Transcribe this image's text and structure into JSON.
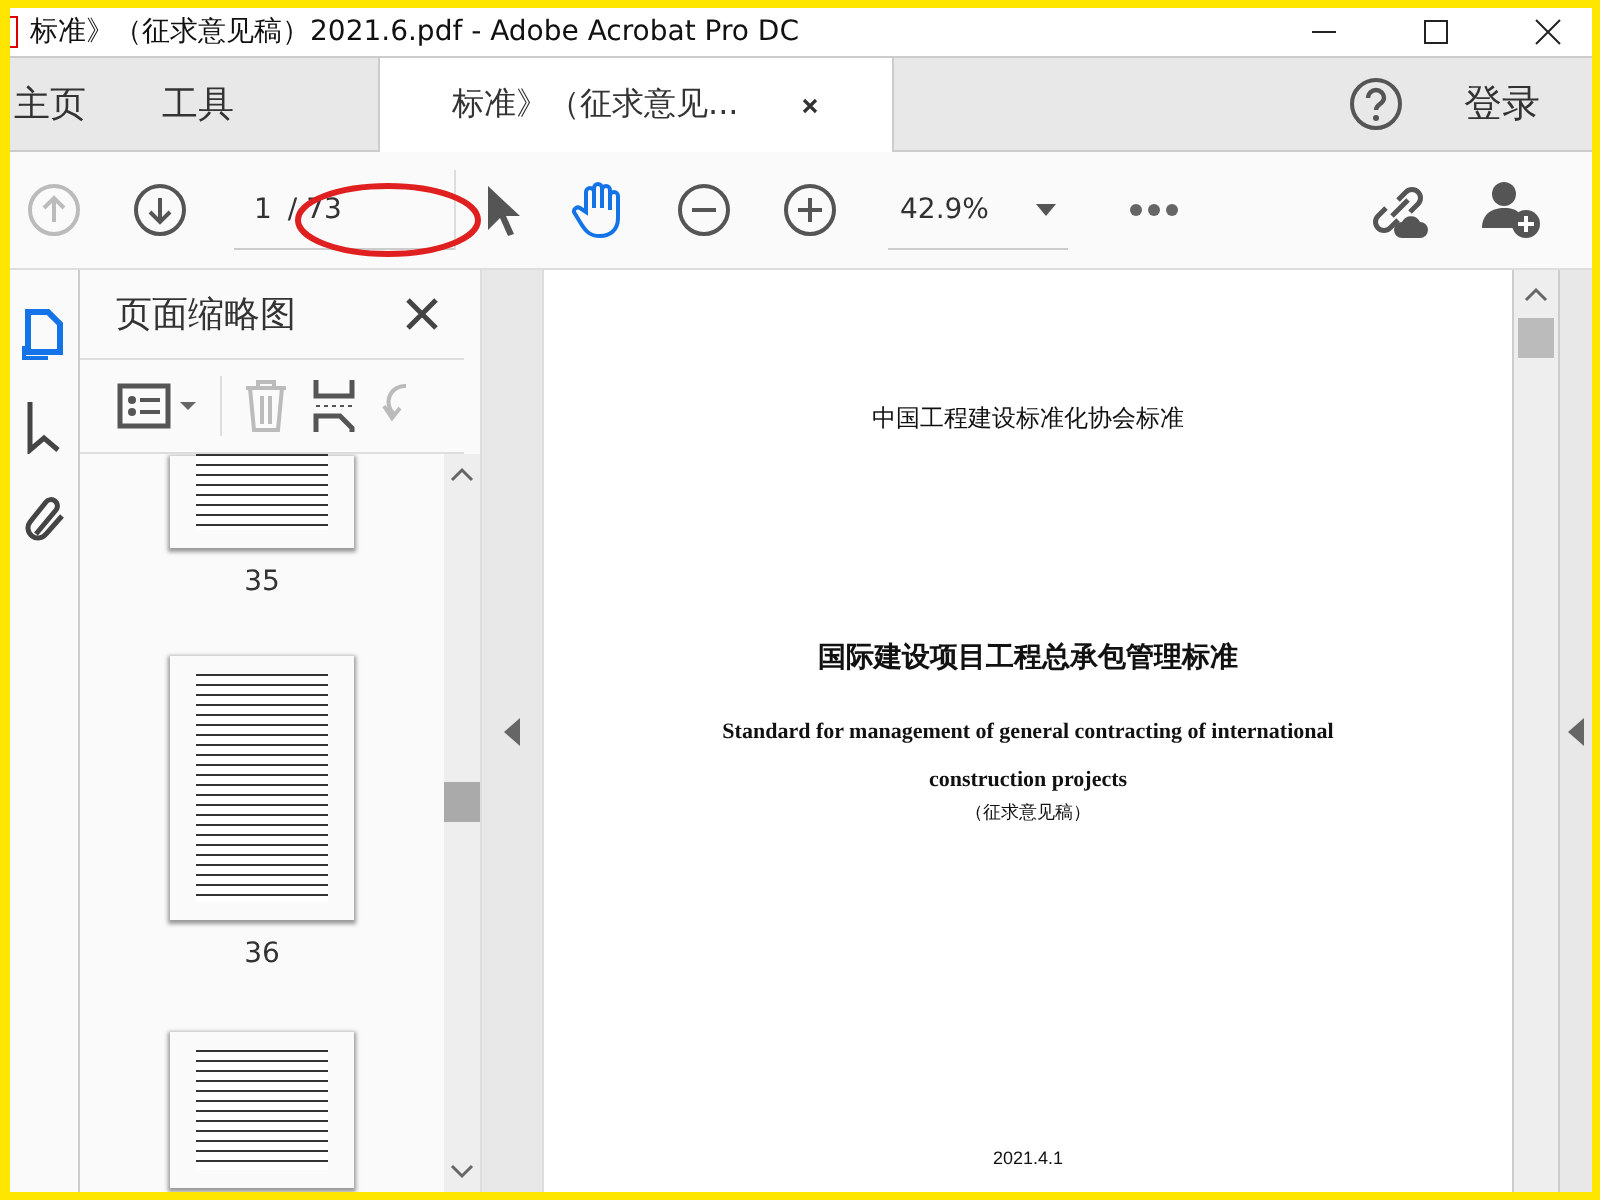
{
  "window": {
    "title": "标准》（征求意见稿）2021.6.pdf - Adobe Acrobat Pro DC"
  },
  "tabs": [
    {
      "label": "主页",
      "selected": false,
      "kind": "nav"
    },
    {
      "label": "工具",
      "selected": false,
      "kind": "nav"
    },
    {
      "label": "标准》（征求意见...",
      "selected": true,
      "kind": "document"
    }
  ],
  "account": {
    "sign_in": "登录"
  },
  "toolbar": {
    "page_number": "1",
    "page_total": "/ 73",
    "zoom": "42.9%"
  },
  "sidebar": {
    "tools": [
      {
        "kind": "pages",
        "selected": true
      },
      {
        "kind": "bookmarks",
        "selected": false
      },
      {
        "kind": "attachments",
        "selected": false
      }
    ]
  },
  "thumbnail_panel": {
    "title": "页面缩略图",
    "pages": [
      {
        "label": "35",
        "kind": "partial-top"
      },
      {
        "label": "36",
        "kind": "full"
      },
      {
        "kind": "partial-bottom"
      }
    ]
  },
  "document": {
    "lines": [
      {
        "kind": "org",
        "text": "中国工程建设标准化协会标准"
      },
      {
        "kind": "title",
        "text": "国际建设项目工程总承包管理标准"
      },
      {
        "kind": "subtitle",
        "text": "Standard for management of general contracting of international"
      },
      {
        "kind": "subtitle2",
        "text": "construction projects"
      },
      {
        "kind": "note",
        "text": "（征求意见稿）"
      },
      {
        "kind": "date",
        "text": "2021.4.1"
      }
    ]
  }
}
